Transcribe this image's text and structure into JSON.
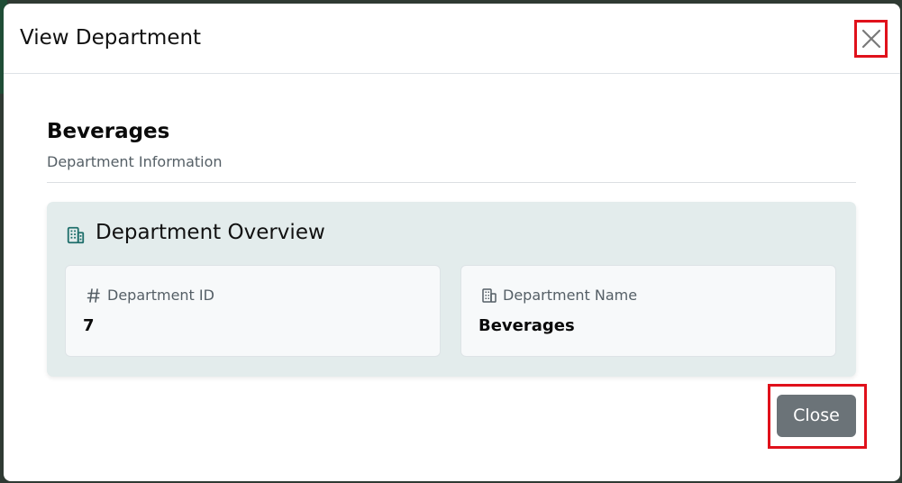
{
  "modal": {
    "title": "View Department"
  },
  "department": {
    "name": "Beverages",
    "subtitle": "Department Information"
  },
  "overview": {
    "title": "Department Overview",
    "fields": [
      {
        "label": "Department ID",
        "value": "7",
        "icon": "hash-icon"
      },
      {
        "label": "Department Name",
        "value": "Beverages",
        "icon": "building-icon"
      }
    ]
  },
  "footer": {
    "close_label": "Close"
  },
  "colors": {
    "accent": "#1f6f6b",
    "close_button_bg": "#6b7378",
    "highlight": "#e0111b"
  }
}
